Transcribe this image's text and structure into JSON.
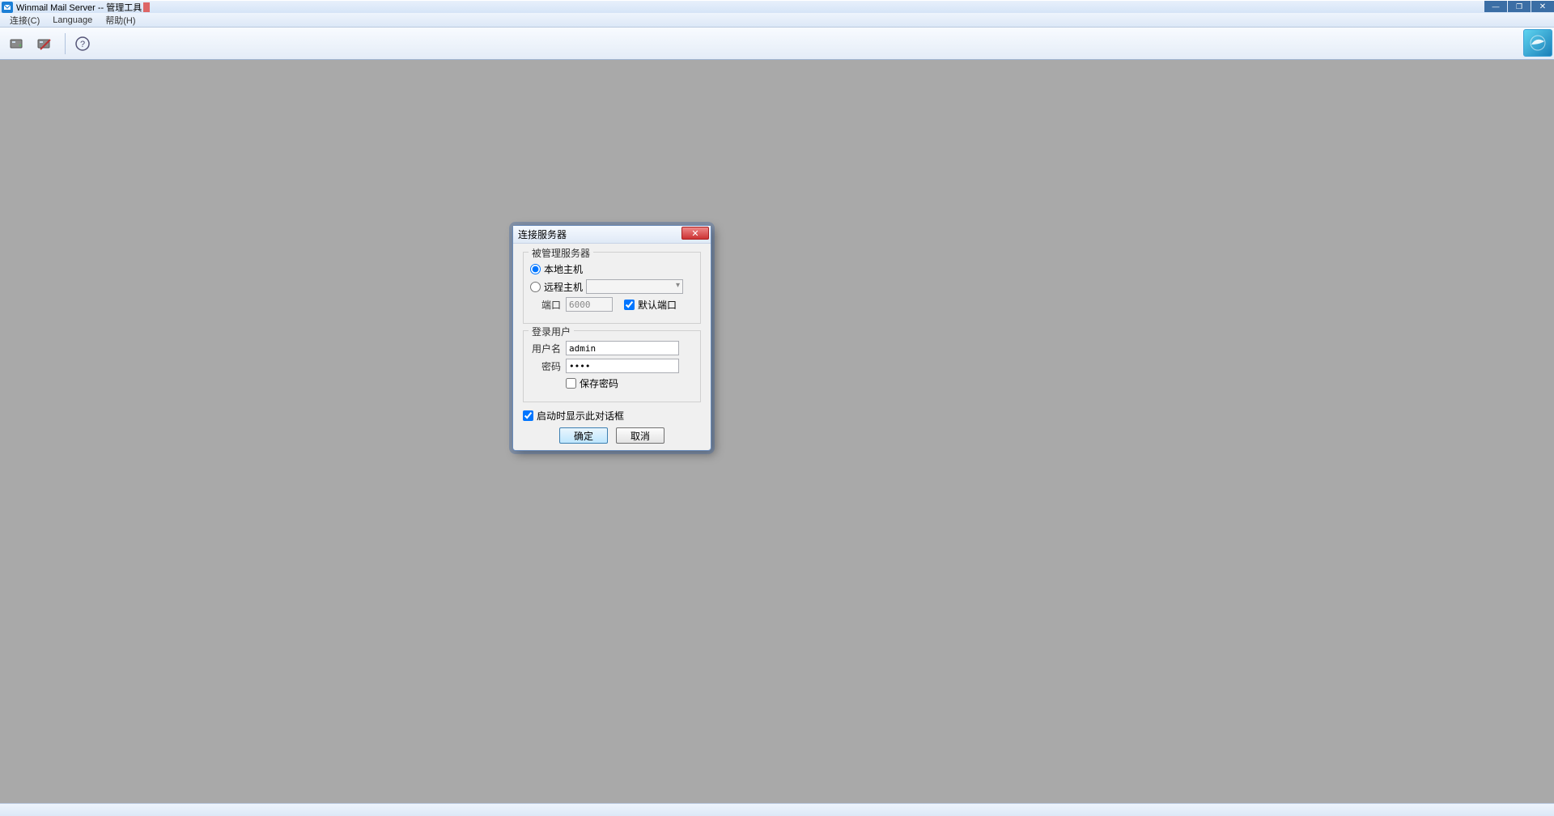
{
  "titlebar": {
    "app_title": "Winmail Mail Server -- 管理工具"
  },
  "menubar": {
    "items": [
      {
        "label": "连接(C)"
      },
      {
        "label": "Language"
      },
      {
        "label": "帮助(H)"
      }
    ]
  },
  "toolbar": {
    "icons": [
      "server-connect-icon",
      "server-disconnect-icon",
      "help-icon"
    ],
    "logo": "app-logo-icon"
  },
  "dialog": {
    "title": "连接服务器",
    "group_server": {
      "title": "被管理服务器",
      "radio_local": "本地主机",
      "radio_remote": "远程主机",
      "remote_host_value": "",
      "port_label": "端口",
      "port_value": "6000",
      "default_port_label": "默认端口",
      "default_port_checked": true,
      "local_selected": true
    },
    "group_login": {
      "title": "登录用户",
      "username_label": "用户名",
      "username_value": "admin",
      "password_label": "密码",
      "password_value": "••••",
      "save_password_label": "保存密码",
      "save_password_checked": false
    },
    "show_on_startup_label": "启动时显示此对话框",
    "show_on_startup_checked": true,
    "ok_label": "确定",
    "cancel_label": "取消"
  }
}
